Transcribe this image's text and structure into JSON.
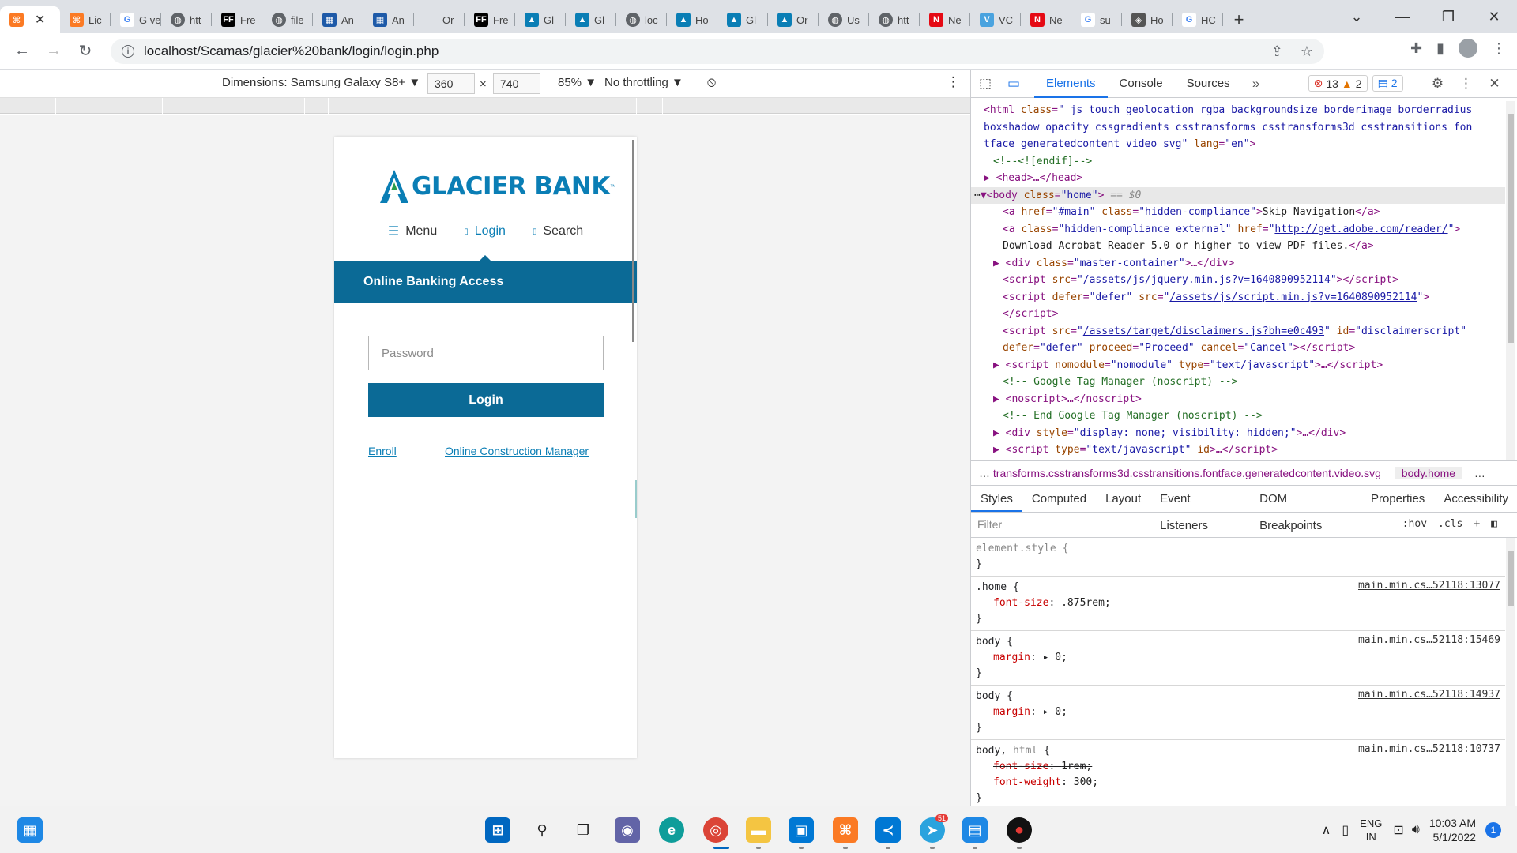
{
  "browser": {
    "tabs": [
      {
        "label": "Lic",
        "fav": "xampp",
        "color": "#fb7a24"
      },
      {
        "label": "G ve",
        "fav": "google",
        "color": "#ffffff"
      },
      {
        "label": "htt",
        "fav": "globe",
        "color": "#5f6368"
      },
      {
        "label": "Fre",
        "fav": "ff",
        "color": "#000000"
      },
      {
        "label": "file",
        "fav": "globe",
        "color": "#5f6368"
      },
      {
        "label": "An",
        "fav": "bank",
        "color": "#1e5aa8"
      },
      {
        "label": "An",
        "fav": "bank",
        "color": "#1e5aa8"
      },
      {
        "label": "Or",
        "fav": "blank",
        "color": "#dee1e6"
      },
      {
        "label": "Fre",
        "fav": "ff",
        "color": "#000000"
      },
      {
        "label": "Gl",
        "fav": "glacier",
        "color": "#0a7eb5"
      },
      {
        "label": "Gl",
        "fav": "glacier",
        "color": "#0a7eb5"
      },
      {
        "label": "loc",
        "fav": "globe",
        "color": "#5f6368"
      },
      {
        "label": "Ho",
        "fav": "glacier",
        "color": "#0a7eb5"
      },
      {
        "label": "Gl",
        "fav": "glacier",
        "color": "#0a7eb5"
      },
      {
        "label": "Or",
        "fav": "glacier",
        "color": "#0a7eb5"
      },
      {
        "label": "Us",
        "fav": "globe",
        "color": "#5f6368"
      },
      {
        "label": "htt",
        "fav": "globe",
        "color": "#5f6368"
      },
      {
        "label": "Ne",
        "fav": "netflix",
        "color": "#e50914"
      },
      {
        "label": "VC",
        "fav": "v",
        "color": "#4aa3df"
      },
      {
        "label": "Ne",
        "fav": "netflix",
        "color": "#e50914"
      },
      {
        "label": "su",
        "fav": "google",
        "color": "#ffffff"
      },
      {
        "label": "Ho",
        "fav": "diamond",
        "color": "#555555"
      },
      {
        "label": "HC",
        "fav": "google",
        "color": "#ffffff"
      }
    ],
    "active_tab_fav_color": "#fb7a24",
    "url": "localhost/Scamas/glacier%20bank/login/login.php"
  },
  "device_toolbar": {
    "dimensions_label": "Dimensions: Samsung Galaxy S8+",
    "width": "360",
    "height": "740",
    "times": "×",
    "zoom": "85%",
    "throttling": "No throttling"
  },
  "page": {
    "logo_text": "GLACIER BANK",
    "logo_tm": "™",
    "nav": {
      "menu": "Menu",
      "login": "Login",
      "search": "Search"
    },
    "banner": "Online Banking Access",
    "password_placeholder": "Password",
    "login_button": "Login",
    "enroll_link": "Enroll",
    "ocm_link": "Online Construction Manager",
    "brand_color": "#0b6a96"
  },
  "devtools": {
    "tabs": [
      "Elements",
      "Console",
      "Sources"
    ],
    "errors": "13",
    "warnings": "2",
    "messages": "2",
    "breadcrumb_path": "transforms.csstransforms3d.csstransitions.fontface.generatedcontent.video.svg",
    "breadcrumb_current": "body.home",
    "subtabs": [
      "Styles",
      "Computed",
      "Layout",
      "Event Listeners",
      "DOM Breakpoints",
      "Properties",
      "Accessibility"
    ],
    "filter_placeholder": "Filter",
    "hov": ":hov",
    "cls": ".cls"
  },
  "taskbar": {
    "lang": "ENG",
    "region": "IN",
    "time": "10:03 AM",
    "date": "5/1/2022",
    "notifications": "1",
    "telegram_badge": "51"
  }
}
